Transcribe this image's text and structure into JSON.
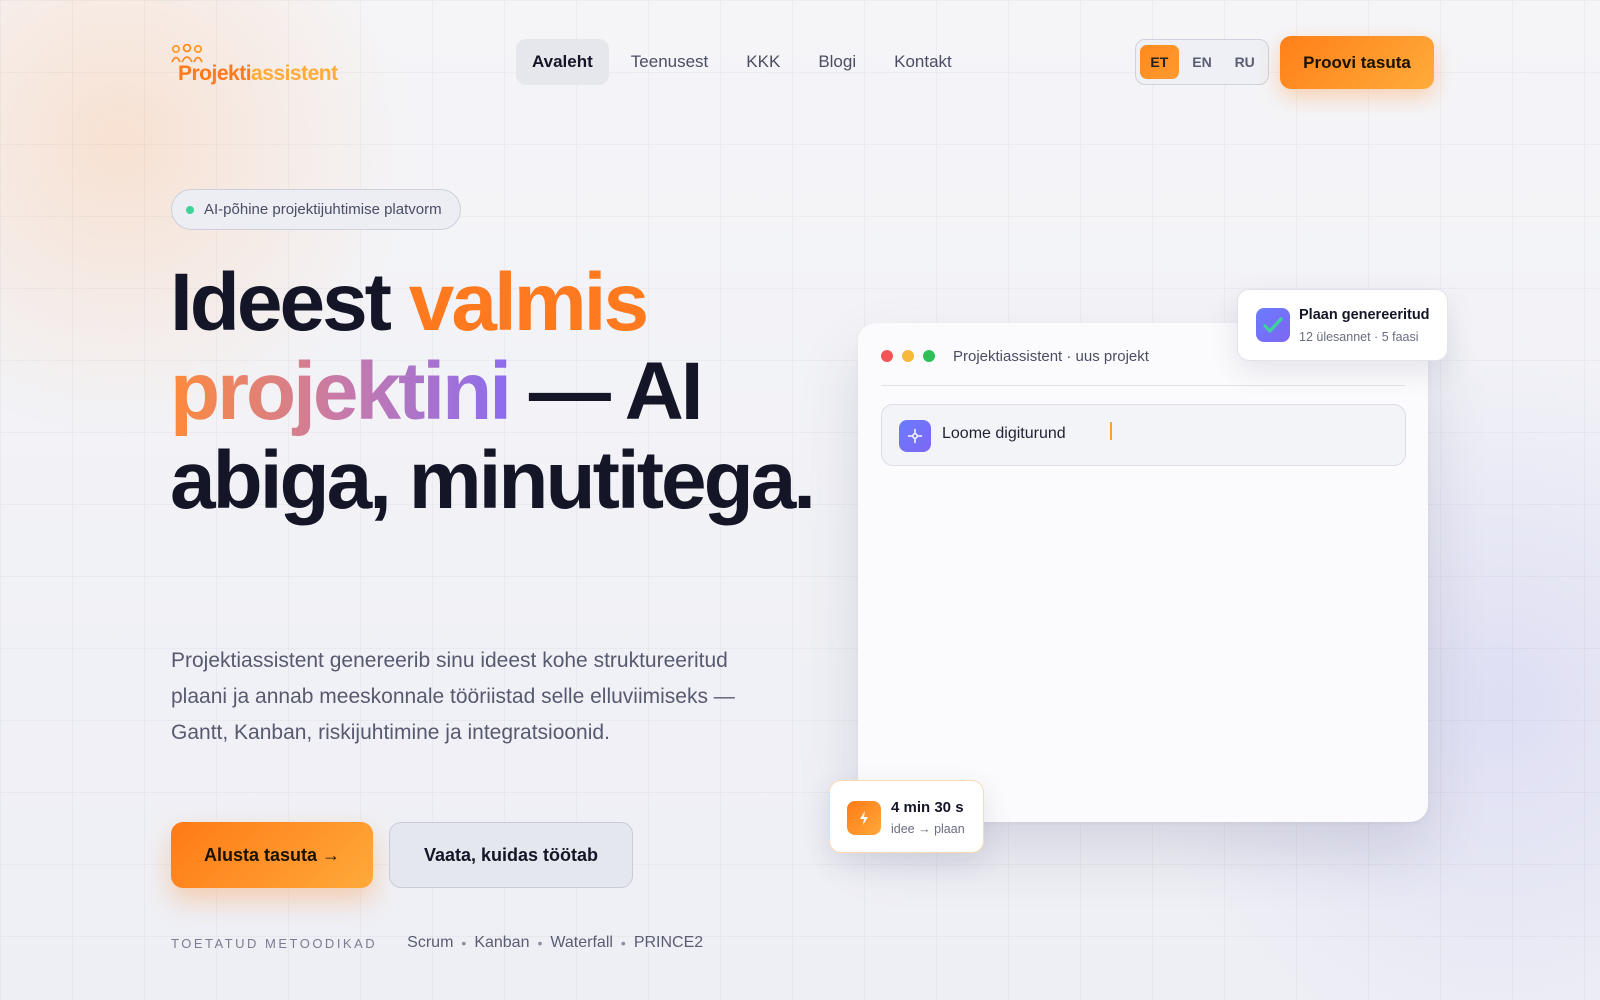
{
  "logo": {
    "text_primary": "Projekti",
    "text_secondary": "assistent"
  },
  "nav": {
    "items": [
      {
        "label": "Avaleht",
        "active": true
      },
      {
        "label": "Teenusest",
        "active": false
      },
      {
        "label": "KKK",
        "active": false
      },
      {
        "label": "Blogi",
        "active": false
      },
      {
        "label": "Kontakt",
        "active": false
      }
    ]
  },
  "languages": {
    "options": [
      "ET",
      "EN",
      "RU"
    ],
    "selected": "ET"
  },
  "header_cta": "Proovi tasuta",
  "hero": {
    "badge": "AI-põhine projektijuhtimise platvorm",
    "headline": {
      "part1": "Ideest ",
      "part2": "valmis",
      "part3": "projektini",
      "part4": " — AI abiga, minutitega."
    },
    "lead": "Projektiassistent genereerib sinu ideest kohe struktureeritud plaani ja annab meeskonnale tööriistad selle elluviimiseks — Gantt, Kanban, riskijuhtimine ja integratsioonid.",
    "primary_button": "Alusta tasuta →",
    "secondary_button": "Vaata, kuidas töötab",
    "methods_label": "TOETATUD METOODIKAD",
    "methods": [
      "Scrum",
      "Kanban",
      "Waterfall",
      "PRINCE2"
    ],
    "methods_separator": "•"
  },
  "app_window": {
    "title": "Projektiassistent · uus projekt",
    "prompt_text": "Loome digiturund",
    "traffic_light_colors": [
      "#f25555",
      "#f6b93b",
      "#2fbf58"
    ]
  },
  "toast": {
    "title": "Plaan genereeritud",
    "subtitle": "12 ülesannet · 5 faasi"
  },
  "timer": {
    "value": "4 min 30 s",
    "subtitle": "idee → plaan"
  },
  "colors": {
    "accent": "#ff7a1f",
    "violet": "#7e66f2",
    "success": "#3ed39a"
  }
}
